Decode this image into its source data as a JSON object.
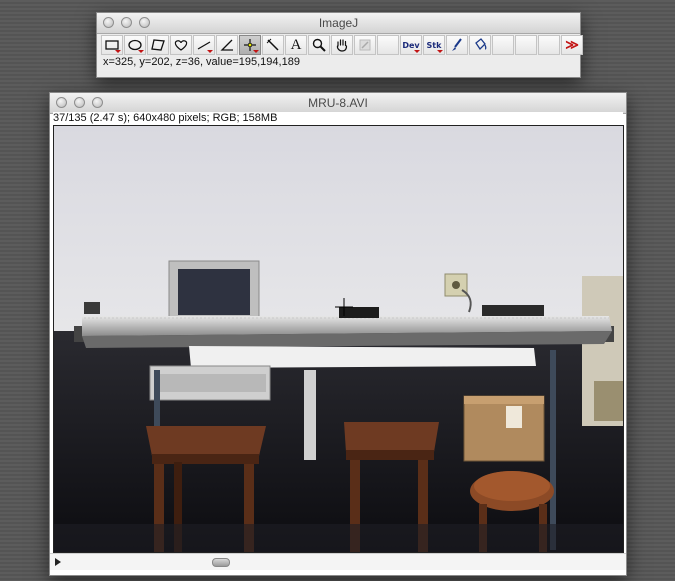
{
  "imagej_window": {
    "title": "ImageJ",
    "status": "x=325, y=202, z=36, value=195,194,189",
    "tools": [
      {
        "name": "rectangle-tool",
        "icon": "rectangle-icon",
        "label": "",
        "selected": false,
        "menu": true
      },
      {
        "name": "oval-tool",
        "icon": "oval-icon",
        "label": "",
        "selected": false,
        "menu": true
      },
      {
        "name": "polygon-tool",
        "icon": "polygon-icon",
        "label": "",
        "selected": false,
        "menu": false
      },
      {
        "name": "freehand-tool",
        "icon": "heart-freehand-icon",
        "label": "",
        "selected": false,
        "menu": false
      },
      {
        "name": "line-tool",
        "icon": "line-icon",
        "label": "",
        "selected": false,
        "menu": true
      },
      {
        "name": "angle-tool",
        "icon": "angle-icon",
        "label": "",
        "selected": false,
        "menu": false
      },
      {
        "name": "point-tool",
        "icon": "crosshair-point-icon",
        "label": "",
        "selected": true,
        "menu": true
      },
      {
        "name": "wand-tool",
        "icon": "wand-icon",
        "label": "",
        "selected": false,
        "menu": false
      },
      {
        "name": "text-tool",
        "icon": "text-a-icon",
        "label": "A",
        "selected": false,
        "menu": false
      },
      {
        "name": "magnifier-tool",
        "icon": "magnifier-icon",
        "label": "",
        "selected": false,
        "menu": false
      },
      {
        "name": "hand-tool",
        "icon": "hand-icon",
        "label": "",
        "selected": false,
        "menu": false
      },
      {
        "name": "dropper-tool",
        "icon": "dropper-icon",
        "label": "",
        "selected": false,
        "menu": false
      },
      {
        "name": "empty-slot-1",
        "icon": "",
        "label": "",
        "selected": false,
        "menu": false
      },
      {
        "name": "dev-tool",
        "icon": "",
        "label": "Dev",
        "selected": false,
        "menu": true
      },
      {
        "name": "stk-tool",
        "icon": "",
        "label": "Stk",
        "selected": false,
        "menu": true
      },
      {
        "name": "brush-tool",
        "icon": "brush-icon",
        "label": "",
        "selected": false,
        "menu": false
      },
      {
        "name": "flood-fill-tool",
        "icon": "bucket-icon",
        "label": "",
        "selected": false,
        "menu": false
      },
      {
        "name": "empty-slot-2",
        "icon": "",
        "label": "",
        "selected": false,
        "menu": false
      },
      {
        "name": "empty-slot-3",
        "icon": "",
        "label": "",
        "selected": false,
        "menu": false
      },
      {
        "name": "empty-slot-4",
        "icon": "",
        "label": "",
        "selected": false,
        "menu": false
      },
      {
        "name": "more-tools",
        "icon": "double-chevron-right-icon",
        "label": "≫",
        "selected": false,
        "menu": false
      }
    ]
  },
  "movie_window": {
    "title": "MRU-8.AVI",
    "info": "37/135 (2.47 s); 640x480 pixels; RGB; 158MB",
    "image_description_icon": "video-frame-photo",
    "colors": {
      "accent_arrow": "#c21414"
    }
  }
}
